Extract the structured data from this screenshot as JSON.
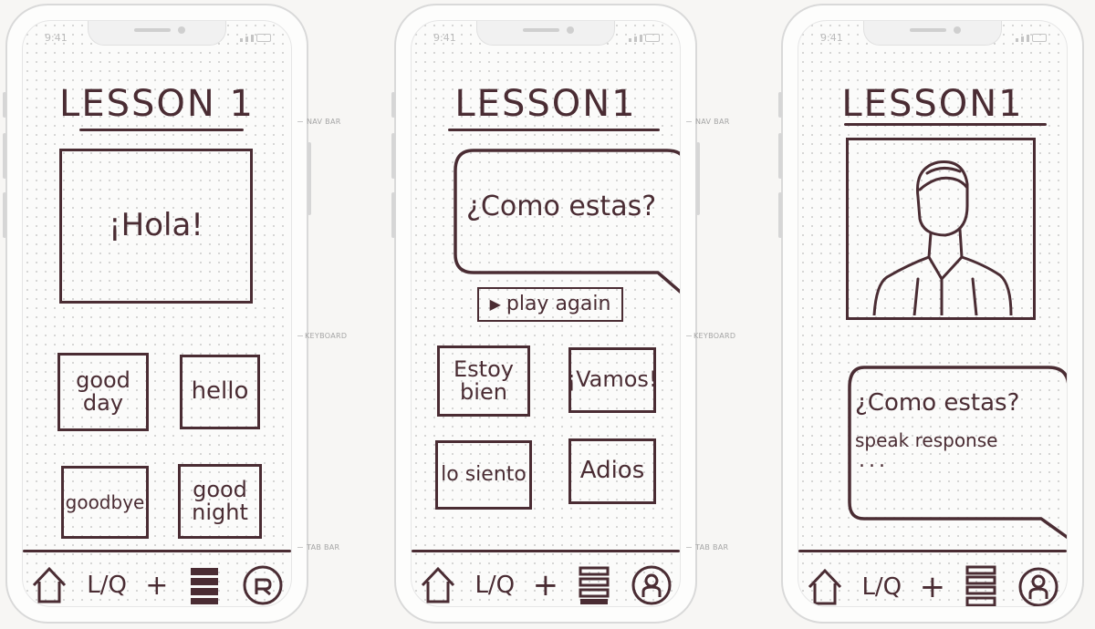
{
  "status_time": "9:41",
  "guide_labels": {
    "nav_bar": "NAV BAR",
    "keyboard": "KEYBOARD",
    "tab_bar": "TAB BAR"
  },
  "screens": [
    {
      "title": "LESSON 1",
      "card_text": "¡Hola!",
      "options": [
        "good day",
        "hello",
        "goodbye",
        "good night"
      ]
    },
    {
      "title": "LESSON1",
      "bubble_text": "¿Como estas?",
      "play_button": "play again",
      "options": [
        "Estoy bien",
        "¡Vamos!",
        "lo siento",
        "Adios"
      ]
    },
    {
      "title": "LESSON1",
      "avatar_desc": "person-portrait",
      "bubble_line1": "¿Como estas?",
      "bubble_line2": "speak response",
      "bubble_line3": "..."
    }
  ],
  "tabbar": {
    "qa_label": "L/Q",
    "add_label": "+"
  },
  "colors": {
    "ink": "#4a2c33",
    "frame": "#d9d9d9",
    "dots": "#c9c9c9"
  }
}
